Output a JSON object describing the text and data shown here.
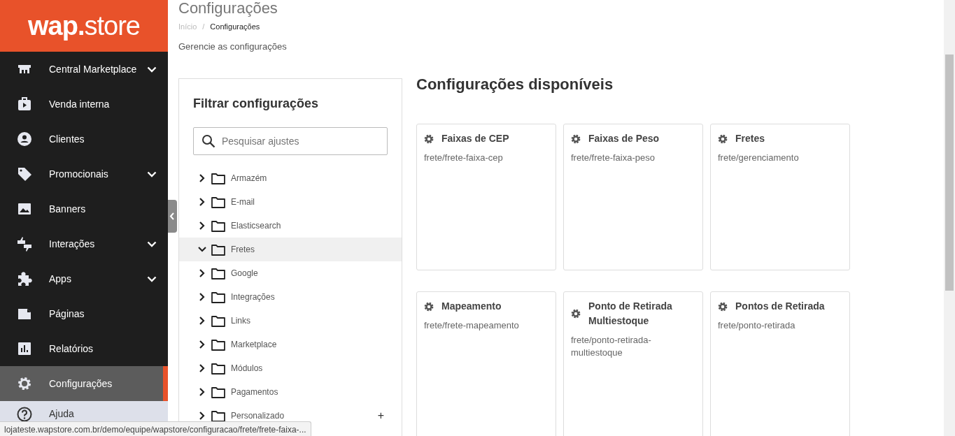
{
  "logo": {
    "bold": "wap",
    "dot": ".",
    "light": "store"
  },
  "sidebar": {
    "items": [
      {
        "label": "Central Marketplace",
        "has_submenu": true,
        "selected": false
      },
      {
        "label": "Venda interna",
        "has_submenu": false,
        "selected": false
      },
      {
        "label": "Clientes",
        "has_submenu": false,
        "selected": false
      },
      {
        "label": "Promocionais",
        "has_submenu": true,
        "selected": false
      },
      {
        "label": "Banners",
        "has_submenu": false,
        "selected": false
      },
      {
        "label": "Interações",
        "has_submenu": true,
        "selected": false
      },
      {
        "label": "Apps",
        "has_submenu": true,
        "selected": false
      },
      {
        "label": "Páginas",
        "has_submenu": false,
        "selected": false
      },
      {
        "label": "Relatórios",
        "has_submenu": false,
        "selected": false
      },
      {
        "label": "Configurações",
        "has_submenu": false,
        "selected": true
      },
      {
        "label": "Ajuda",
        "has_submenu": false,
        "selected": false,
        "kind": "help"
      }
    ]
  },
  "page": {
    "title": "Configurações",
    "breadcrumb": [
      {
        "label": "Início"
      },
      {
        "label": "Configurações"
      }
    ],
    "breadcrumb_separator": "/",
    "subtitle": "Gerencie as configurações"
  },
  "filter": {
    "title": "Filtrar configurações",
    "search": {
      "placeholder": "Pesquisar ajustes"
    },
    "tree": [
      {
        "label": "Armazém",
        "expanded": false,
        "selected": false
      },
      {
        "label": "E-mail",
        "expanded": false,
        "selected": false
      },
      {
        "label": "Elasticsearch",
        "expanded": false,
        "selected": false
      },
      {
        "label": "Fretes",
        "expanded": true,
        "selected": true
      },
      {
        "label": "Google",
        "expanded": false,
        "selected": false
      },
      {
        "label": "Integrações",
        "expanded": false,
        "selected": false
      },
      {
        "label": "Links",
        "expanded": false,
        "selected": false
      },
      {
        "label": "Marketplace",
        "expanded": false,
        "selected": false
      },
      {
        "label": "Módulos",
        "expanded": false,
        "selected": false
      },
      {
        "label": "Pagamentos",
        "expanded": false,
        "selected": false
      },
      {
        "label": "Personalizado",
        "expanded": false,
        "selected": false,
        "action": "+"
      }
    ]
  },
  "available": {
    "title": "Configurações disponíveis",
    "cards": [
      {
        "title": "Faixas de CEP",
        "path": "frete/frete-faixa-cep"
      },
      {
        "title": "Faixas de Peso",
        "path": "frete/frete-faixa-peso"
      },
      {
        "title": "Fretes",
        "path": "frete/gerenciamento"
      },
      {
        "title": "Mapeamento",
        "path": "frete/frete-mapeamento"
      },
      {
        "title": "Ponto de Retirada Multiestoque",
        "path": "frete/ponto-retirada-multiestoque"
      },
      {
        "title": "Pontos de Retirada",
        "path": "frete/ponto-retirada"
      }
    ]
  },
  "status_bar": {
    "url": "lojateste.wapstore.com.br/demo/equipe/wapstore/configuracao/frete/frete-faixa-..."
  }
}
